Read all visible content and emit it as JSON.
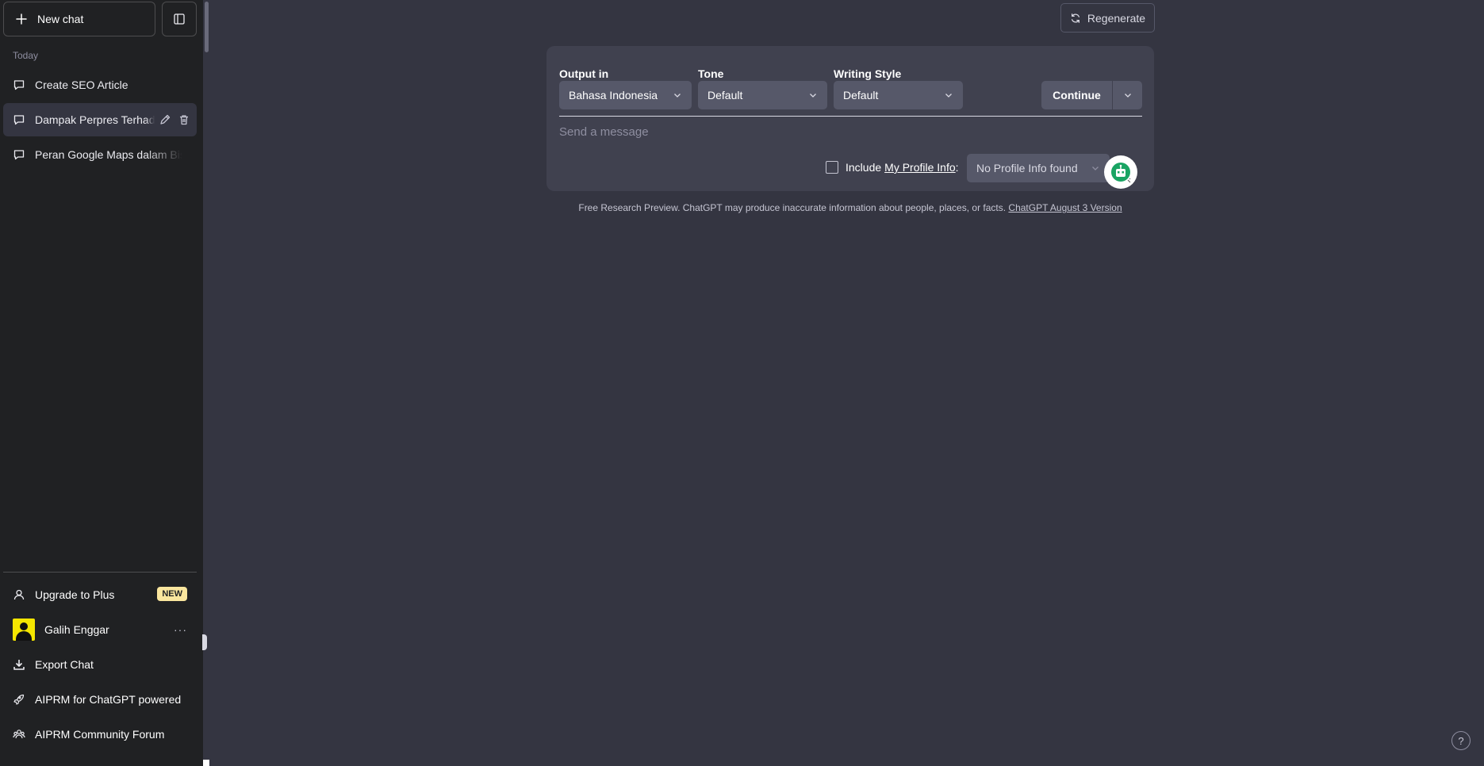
{
  "sidebar": {
    "new_chat_label": "New chat",
    "section_today": "Today",
    "chats": [
      {
        "title": "Create SEO Article"
      },
      {
        "title": "Dampak Perpres Terhadap"
      },
      {
        "title": "Peran Google Maps dalam Bisnis"
      }
    ],
    "upgrade_label": "Upgrade to Plus",
    "upgrade_badge": "NEW",
    "user_name": "Galih Enggar",
    "more_label": "···",
    "export_label": "Export Chat",
    "aiprm_powered_label": "AIPRM for ChatGPT powered",
    "aiprm_forum_label": "AIPRM Community Forum"
  },
  "main": {
    "regenerate_label": "Regenerate",
    "output_label": "Output in",
    "output_value": "Bahasa Indonesia",
    "tone_label": "Tone",
    "tone_value": "Default",
    "style_label": "Writing Style",
    "style_value": "Default",
    "continue_label": "Continue",
    "message_placeholder": "Send a message",
    "include_label": "Include",
    "profile_link_label": "My Profile Info",
    "colon": ":",
    "profile_select_value": "No Profile Info found",
    "footer_text": "Free Research Preview. ChatGPT may produce inaccurate information about people, places, or facts. ",
    "footer_link": "ChatGPT August 3 Version",
    "help_label": "?"
  },
  "colors": {
    "sidebar_bg": "#202123",
    "main_bg": "#343541",
    "panel_bg": "#40414f",
    "badge_bg": "#fae69e",
    "bot_green": "#19a463"
  }
}
